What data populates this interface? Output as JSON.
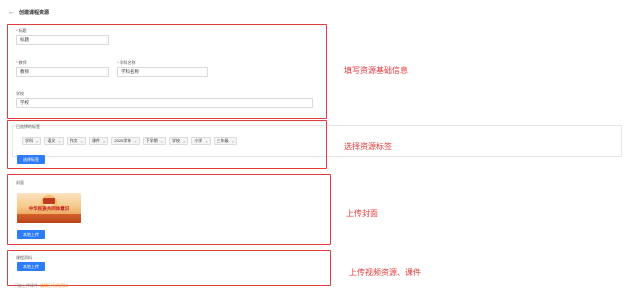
{
  "header": {
    "back_icon": "arrow-left-icon",
    "title": "创建课程资源"
  },
  "basic_info": {
    "title_label": "标题",
    "title_value": "标题",
    "teacher_label": "教师",
    "teacher_value": "教师",
    "subject_label": "学科名称",
    "subject_value": "学科名称",
    "school_label": "学校",
    "school_value": "学校",
    "annotation": "填写资源基础信息"
  },
  "tags": {
    "label": "已选择的标签",
    "items": [
      "学科",
      "语文",
      "作文",
      "课件",
      "2020学年",
      "下学期",
      "学校",
      "小学",
      "三年级"
    ],
    "select_button": "选择标签",
    "annotation": "选择资源标签"
  },
  "cover": {
    "label": "封面",
    "image_text": "中华民族共同体意识",
    "upload_button": "本地上传",
    "annotation": "上传封面"
  },
  "course_material": {
    "label": "课程资料",
    "upload_button": "本地上传",
    "annotation": "上传视频资源、课件"
  },
  "footer": {
    "note": "只能上传课件",
    "link": "编辑已有的资料"
  },
  "colors": {
    "accent": "#2e7cf6",
    "annotation": "#e23b3b",
    "required": "#e23b3b",
    "link": "#f08c2e"
  }
}
